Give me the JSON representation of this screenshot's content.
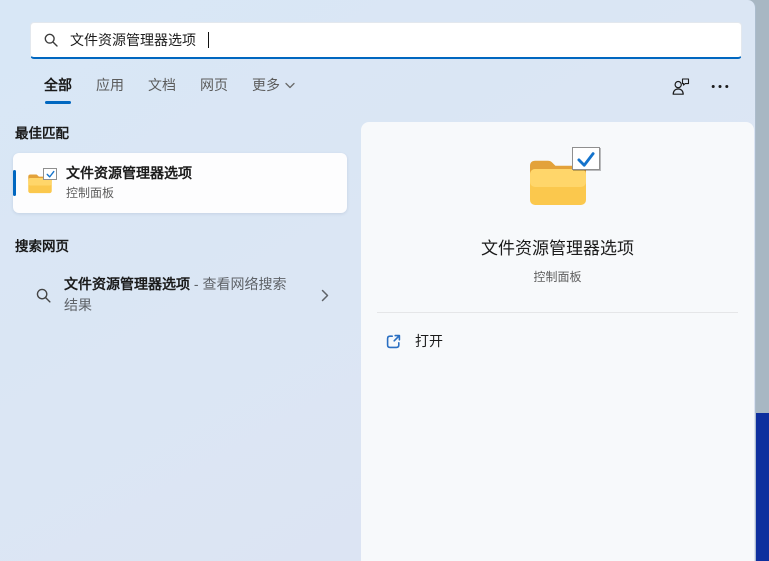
{
  "colors": {
    "accent": "#0067c0",
    "folder_yellow": "#fbc84d",
    "folder_tab": "#e3a23a",
    "check_blue": "#1473cc",
    "desktop_strip_top": "#a8b7c3",
    "desktop_strip_bottom": "#0e2f9e"
  },
  "search_box": {
    "value": "文件资源管理器选项"
  },
  "tabs": {
    "all": "全部",
    "apps": "应用",
    "docs": "文档",
    "web": "网页",
    "more": "更多"
  },
  "sections": {
    "best_match": {
      "heading": "最佳匹配",
      "item": {
        "title": "文件资源管理器选项",
        "subtitle": "控制面板"
      }
    },
    "web_search": {
      "heading": "搜索网页",
      "item": {
        "query": "文件资源管理器选项",
        "suffix": " - 查看网络搜索结果"
      }
    }
  },
  "preview": {
    "title": "文件资源管理器选项",
    "subtitle": "控制面板",
    "open_label": "打开"
  }
}
